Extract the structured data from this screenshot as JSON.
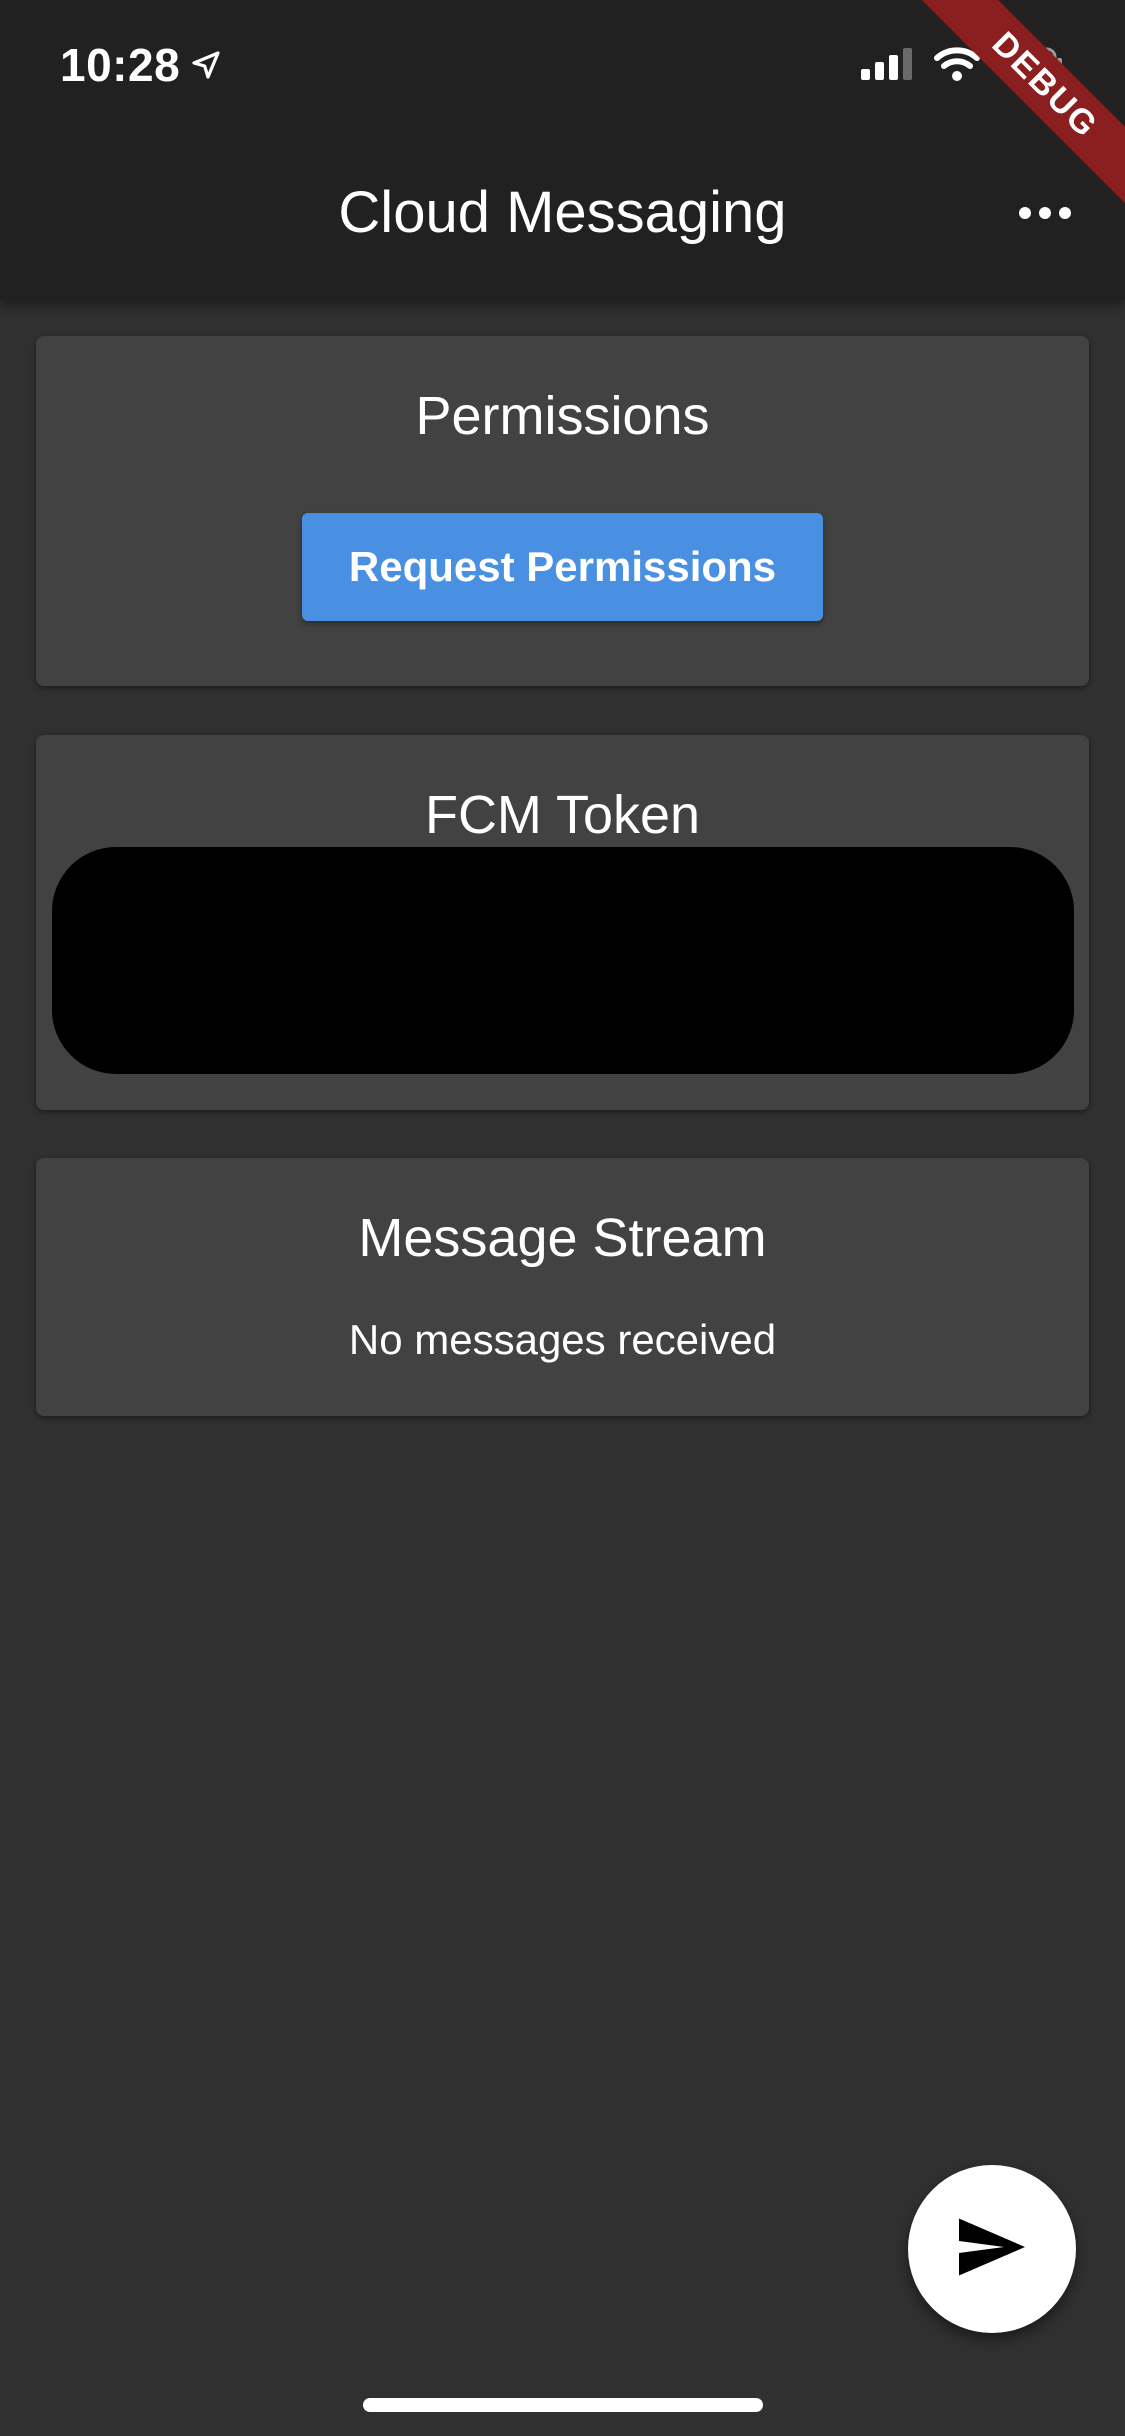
{
  "status_bar": {
    "time": "10:28",
    "icons": [
      "location-arrow-icon",
      "cellular-signal-icon",
      "wifi-icon",
      "battery-charging-icon"
    ]
  },
  "debug_banner": "DEBUG",
  "app_bar": {
    "title": "Cloud Messaging",
    "menu_icon": "more-horizontal-icon"
  },
  "cards": {
    "permissions": {
      "title": "Permissions",
      "button_label": "Request Permissions"
    },
    "token": {
      "title": "FCM Token"
    },
    "stream": {
      "title": "Message Stream",
      "empty_text": "No messages received"
    }
  },
  "fab": {
    "icon": "send-icon"
  },
  "colors": {
    "background": "#303030",
    "app_bar": "#212121",
    "card": "#424242",
    "accent_button": "#4a90e2",
    "debug_banner": "#8b1f1f"
  }
}
